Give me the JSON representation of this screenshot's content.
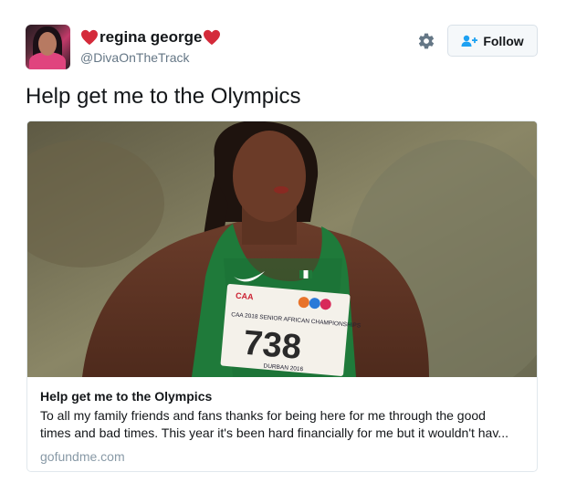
{
  "user": {
    "display_name": "regina george",
    "handle": "@DivaOnTheTrack",
    "heart_color": "#d42a3a"
  },
  "actions": {
    "settings_icon": "gear-icon",
    "follow_label": "Follow",
    "follow_icon": "add-person-icon",
    "accent_color": "#1da1f2"
  },
  "tweet": {
    "text": "Help get me to the Olympics"
  },
  "card": {
    "image_bib_number": "738",
    "image_bib_event": "CAA 2018 SENIOR AFRICAN CHAMPIONSHIPS",
    "image_bib_city": "DURBAN 2016",
    "image_bib_org": "CAA",
    "title": "Help get me to the Olympics",
    "description": "To all my family friends and fans thanks for being here for me through the good\ntimes and bad times. This year it's been hard financially for me but it wouldn't hav...",
    "domain": "gofundme.com"
  }
}
